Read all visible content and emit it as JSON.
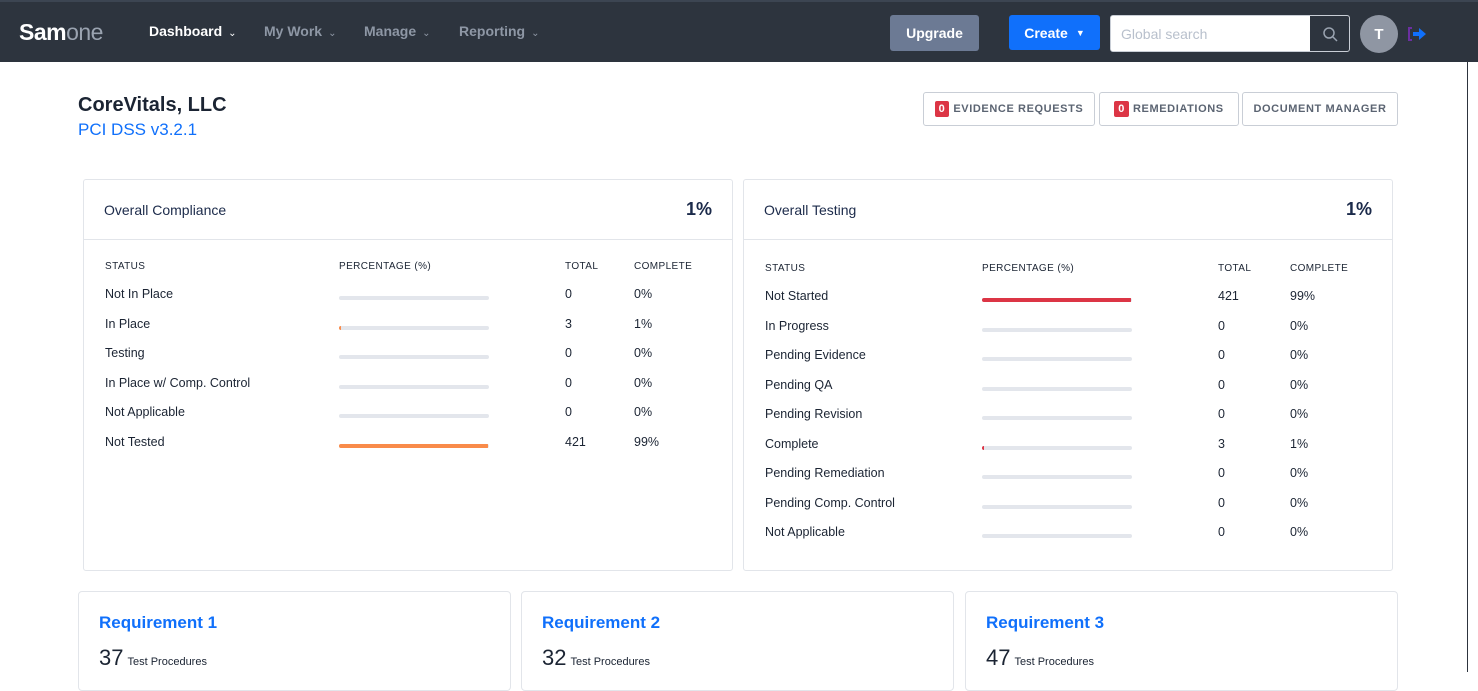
{
  "nav": {
    "logo_bold": "Sam",
    "logo_light": "one",
    "menu": [
      {
        "label": "Dashboard",
        "active": true
      },
      {
        "label": "My Work"
      },
      {
        "label": "Manage"
      },
      {
        "label": "Reporting"
      }
    ],
    "upgrade": "Upgrade",
    "create": "Create",
    "search_placeholder": "Global search",
    "avatar": "T"
  },
  "header": {
    "org": "CoreVitals, LLC",
    "framework": "PCI DSS v3.2.1",
    "buttons": [
      {
        "count": "0",
        "label": "EVIDENCE REQUESTS"
      },
      {
        "count": "0",
        "label": "REMEDIATIONS"
      },
      {
        "label": "DOCUMENT MANAGER"
      }
    ]
  },
  "compliance": {
    "title": "Overall Compliance",
    "percent": "1%",
    "columns": [
      "STATUS",
      "PERCENTAGE (%)",
      "TOTAL",
      "COMPLETE"
    ],
    "rows": [
      {
        "status": "Not In Place",
        "total": "0",
        "complete": "0%",
        "fill": 0
      },
      {
        "status": "In Place",
        "total": "3",
        "complete": "1%",
        "fill": 1
      },
      {
        "status": "Testing",
        "total": "0",
        "complete": "0%",
        "fill": 0
      },
      {
        "status": "In Place w/ Comp. Control",
        "total": "0",
        "complete": "0%",
        "fill": 0
      },
      {
        "status": "Not Applicable",
        "total": "0",
        "complete": "0%",
        "fill": 0
      },
      {
        "status": "Not Tested",
        "total": "421",
        "complete": "99%",
        "fill": 99
      }
    ],
    "color": "#f98b4a"
  },
  "testing": {
    "title": "Overall Testing",
    "percent": "1%",
    "columns": [
      "STATUS",
      "PERCENTAGE (%)",
      "TOTAL",
      "COMPLETE"
    ],
    "rows": [
      {
        "status": "Not Started",
        "total": "421",
        "complete": "99%",
        "fill": 99
      },
      {
        "status": "In Progress",
        "total": "0",
        "complete": "0%",
        "fill": 0
      },
      {
        "status": "Pending Evidence",
        "total": "0",
        "complete": "0%",
        "fill": 0
      },
      {
        "status": "Pending QA",
        "total": "0",
        "complete": "0%",
        "fill": 0
      },
      {
        "status": "Pending Revision",
        "total": "0",
        "complete": "0%",
        "fill": 0
      },
      {
        "status": "Complete",
        "total": "3",
        "complete": "1%",
        "fill": 1
      },
      {
        "status": "Pending Remediation",
        "total": "0",
        "complete": "0%",
        "fill": 0
      },
      {
        "status": "Pending Comp. Control",
        "total": "0",
        "complete": "0%",
        "fill": 0
      },
      {
        "status": "Not Applicable",
        "total": "0",
        "complete": "0%",
        "fill": 0
      }
    ],
    "color": "#dc3545"
  },
  "requirements": [
    {
      "title": "Requirement 1",
      "count": "37",
      "label": "Test Procedures"
    },
    {
      "title": "Requirement 2",
      "count": "32",
      "label": "Test Procedures"
    },
    {
      "title": "Requirement 3",
      "count": "47",
      "label": "Test Procedures"
    }
  ]
}
